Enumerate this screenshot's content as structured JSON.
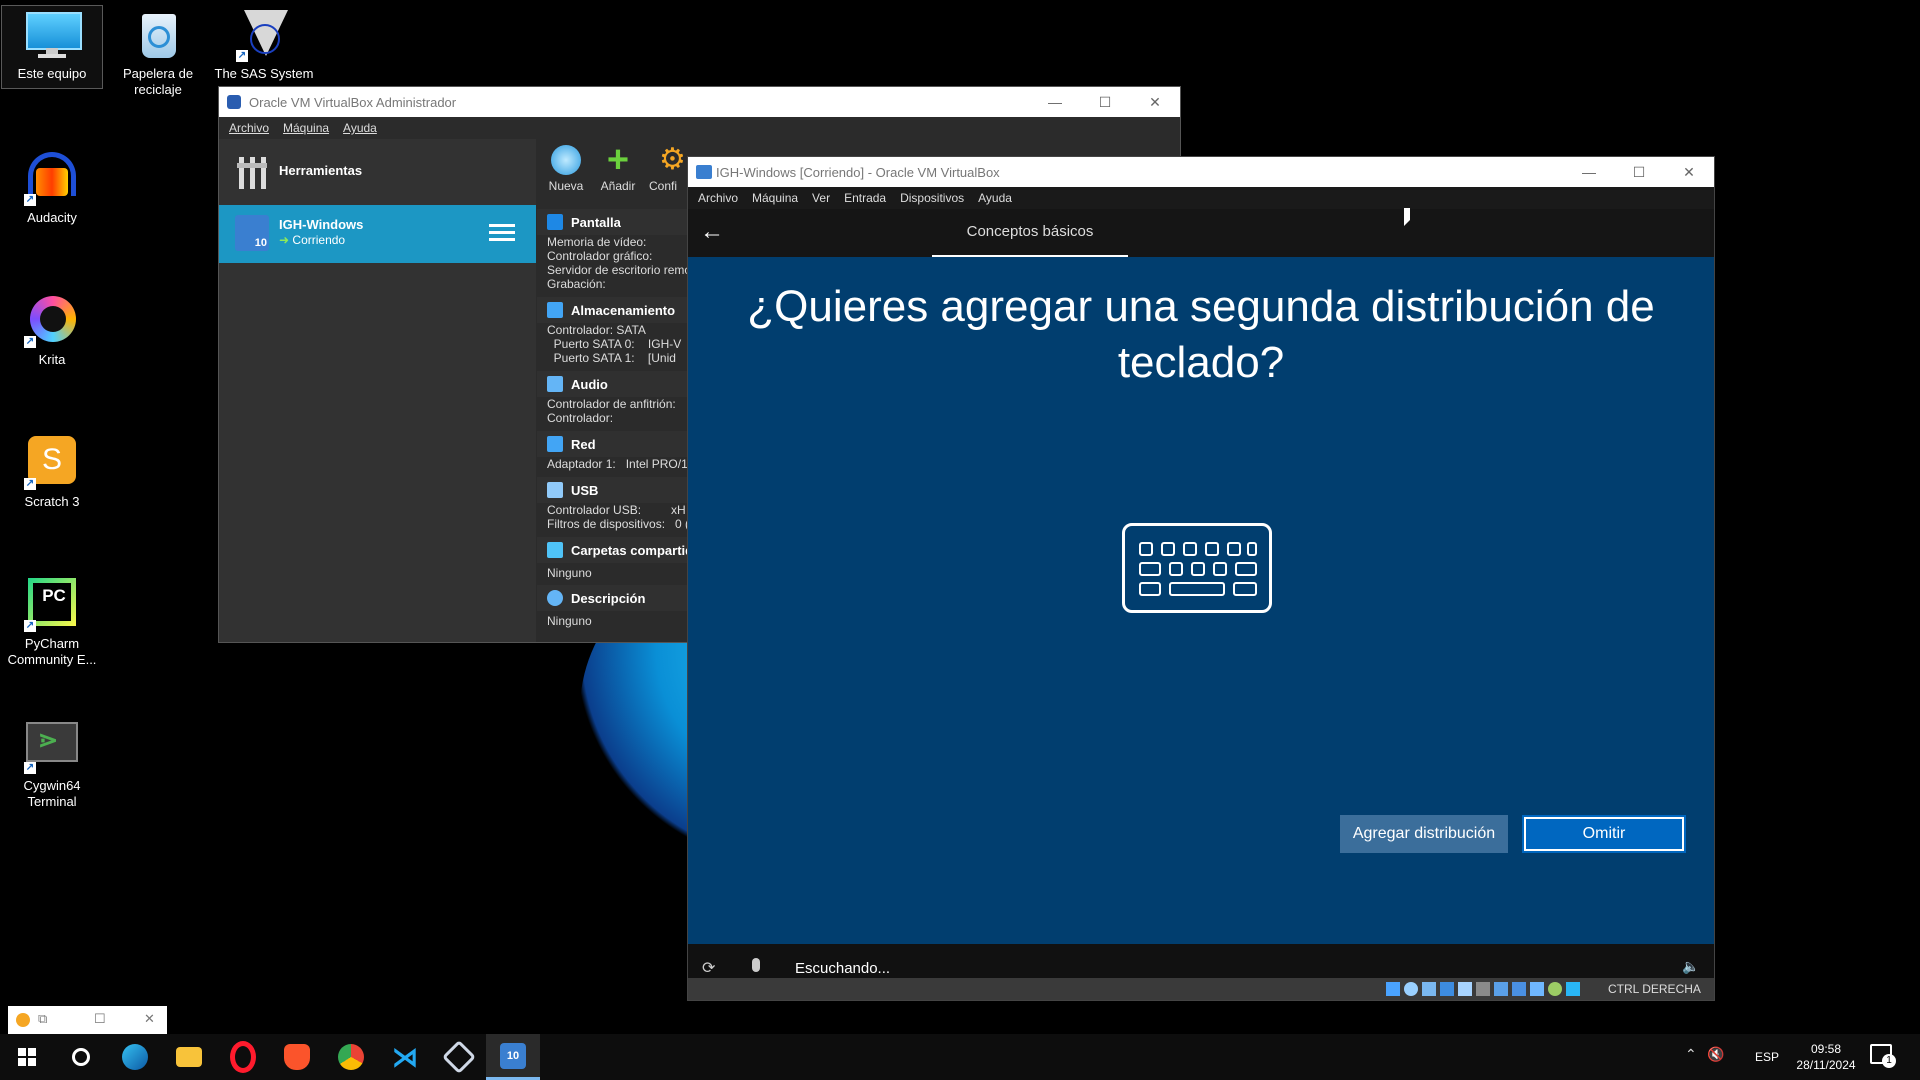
{
  "desktop": {
    "icons": [
      {
        "label": "Este equipo",
        "color": "#29a8e8"
      },
      {
        "label": "Papelera de reciclaje",
        "color": "#9ec9e8"
      },
      {
        "label": "The SAS System",
        "color": "#e0e0e0"
      },
      {
        "label": "Audacity",
        "color": "#1e4fd6"
      },
      {
        "label": "Krita",
        "color": "#5fc4f0"
      },
      {
        "label": "Scratch 3",
        "color": "#f5a623"
      },
      {
        "label": "PyCharm Community E...",
        "color": "#21d789"
      },
      {
        "label": "Cygwin64 Terminal",
        "color": "#3a3a3a"
      }
    ]
  },
  "manager": {
    "title": "Oracle VM VirtualBox Administrador",
    "menu": [
      "Archivo",
      "Máquina",
      "Ayuda"
    ],
    "tools_label": "Herramientas",
    "toolbar": [
      "Nueva",
      "Añadir",
      "Confi"
    ],
    "vm_item": {
      "name": "IGH-Windows",
      "state": "Corriendo"
    },
    "sections": [
      {
        "title": "Pantalla",
        "color": "#1e88e5",
        "lines": [
          "Memoria de vídeo:",
          "Controlador gráfico:",
          "Servidor de escritorio remo",
          "Grabación:"
        ]
      },
      {
        "title": "Almacenamiento",
        "color": "#42a5f5",
        "lines": [
          "Controlador: SATA",
          "  Puerto SATA 0:    IGH-V",
          "  Puerto SATA 1:    [Unid"
        ]
      },
      {
        "title": "Audio",
        "color": "#64b5f6",
        "lines": [
          "Controlador de anfitrión:",
          "Controlador:"
        ]
      },
      {
        "title": "Red",
        "color": "#42a5f5",
        "lines": [
          "Adaptador 1:   Intel PRO/1"
        ]
      },
      {
        "title": "USB",
        "color": "#90caf9",
        "lines": [
          "Controlador USB:         xH",
          "Filtros de dispositivos:   0 ("
        ]
      },
      {
        "title": "Carpetas compartid",
        "color": "#4fc3f7",
        "lines": [
          "Ninguno"
        ]
      },
      {
        "title": "Descripción",
        "color": "#64b5f6",
        "lines": [
          "Ninguno"
        ]
      }
    ]
  },
  "vm": {
    "title": "IGH-Windows [Corriendo] - Oracle VM VirtualBox",
    "menu": [
      "Archivo",
      "Máquina",
      "Ver",
      "Entrada",
      "Dispositivos",
      "Ayuda"
    ],
    "tab": "Conceptos básicos",
    "question": "¿Quieres agregar una segunda distribución de teclado?",
    "add_button": "Agregar distribución",
    "skip_button": "Omitir",
    "listening": "Escuchando...",
    "host_key": "CTRL DERECHA"
  },
  "taskbar": {
    "lang": "ESP",
    "time": "09:58",
    "date": "28/11/2024",
    "notif_count": "1"
  }
}
